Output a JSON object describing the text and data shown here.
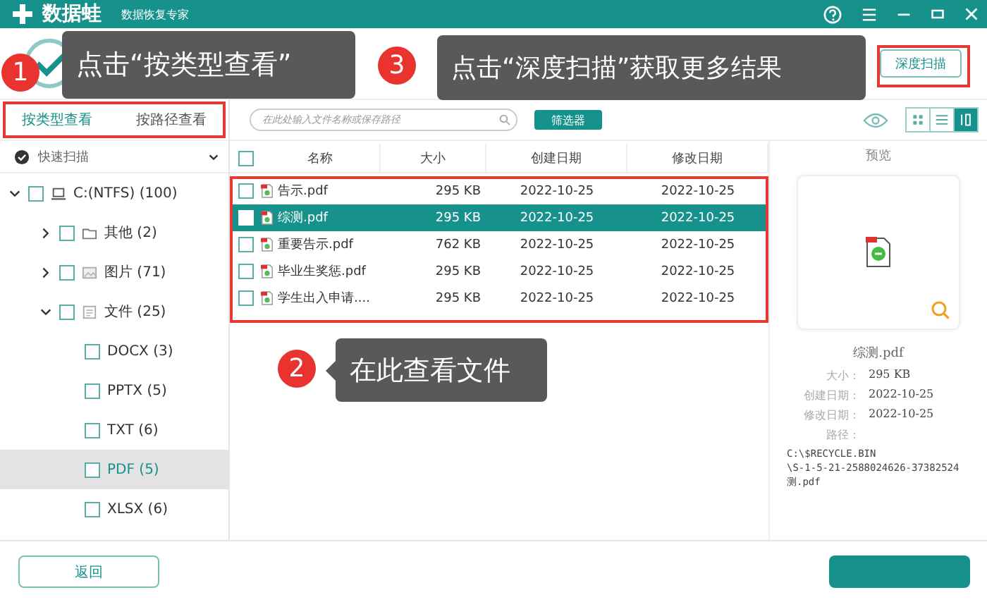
{
  "window": {
    "logo": "数据蛙",
    "subtitle": "数据恢复专家"
  },
  "header": {
    "deep_scan_button": "深度扫描"
  },
  "view_tabs": [
    {
      "label": "按类型查看",
      "selected": true
    },
    {
      "label": "按路径查看",
      "selected": false
    }
  ],
  "search": {
    "placeholder": "在此处输入文件名称或保存路径"
  },
  "filter_button": "筛选器",
  "view_modes": [
    {
      "kind": "grid",
      "selected": false
    },
    {
      "kind": "list",
      "selected": false
    },
    {
      "kind": "detail",
      "selected": true
    }
  ],
  "scan_mode": {
    "label": "快速扫描"
  },
  "tree": [
    {
      "label": "C:(NTFS) (100)",
      "kind": "drive",
      "expanded": true,
      "checked": false,
      "selected": false,
      "children": [
        {
          "label": "其他 (2)",
          "kind": "folder",
          "expanded": false,
          "checked": false,
          "selected": false
        },
        {
          "label": "图片 (71)",
          "kind": "image",
          "expanded": false,
          "checked": false,
          "selected": false
        },
        {
          "label": "文件 (25)",
          "kind": "document",
          "expanded": true,
          "checked": false,
          "selected": false,
          "children": [
            {
              "label": "DOCX (3)",
              "checked": false,
              "selected": false
            },
            {
              "label": "PPTX (5)",
              "checked": false,
              "selected": false
            },
            {
              "label": "TXT (6)",
              "checked": false,
              "selected": false
            },
            {
              "label": "PDF (5)",
              "checked": false,
              "selected": true
            },
            {
              "label": "XLSX (6)",
              "checked": false,
              "selected": false
            }
          ]
        }
      ]
    }
  ],
  "table": {
    "all_checked": false,
    "columns": [
      "名称",
      "大小",
      "创建日期",
      "修改日期"
    ],
    "rows": [
      {
        "name": "告示.pdf",
        "size": "295 KB",
        "created": "2022-10-25",
        "modified": "2022-10-25",
        "checked": false,
        "selected": false
      },
      {
        "name": "综测.pdf",
        "size": "295 KB",
        "created": "2022-10-25",
        "modified": "2022-10-25",
        "checked": false,
        "selected": true
      },
      {
        "name": "重要告示.pdf",
        "size": "762 KB",
        "created": "2022-10-25",
        "modified": "2022-10-25",
        "checked": false,
        "selected": false
      },
      {
        "name": "毕业生奖惩.pdf",
        "size": "295 KB",
        "created": "2022-10-25",
        "modified": "2022-10-25",
        "checked": false,
        "selected": false
      },
      {
        "name": "学生出入申请....",
        "size": "295 KB",
        "created": "2022-10-25",
        "modified": "2022-10-25",
        "checked": false,
        "selected": false
      }
    ]
  },
  "preview": {
    "title": "预览",
    "file_name": "综测.pdf",
    "details": [
      {
        "label": "大小：",
        "value": "295 KB"
      },
      {
        "label": "创建日期：",
        "value": "2022-10-25"
      },
      {
        "label": "修改日期：",
        "value": "2022-10-25"
      }
    ],
    "path_label": "路径：",
    "path_lines": [
      "C:\\$RECYCLE.BIN",
      "\\S-1-5-21-2588024626-37382524",
      "测.pdf"
    ]
  },
  "footer": {
    "back_button": "返回"
  },
  "callouts": [
    {
      "number": "1",
      "text": "点击“按类型查看”"
    },
    {
      "number": "3",
      "text": "点击“深度扫描”获取更多结果"
    },
    {
      "number": "2",
      "text": "在此查看文件"
    }
  ]
}
